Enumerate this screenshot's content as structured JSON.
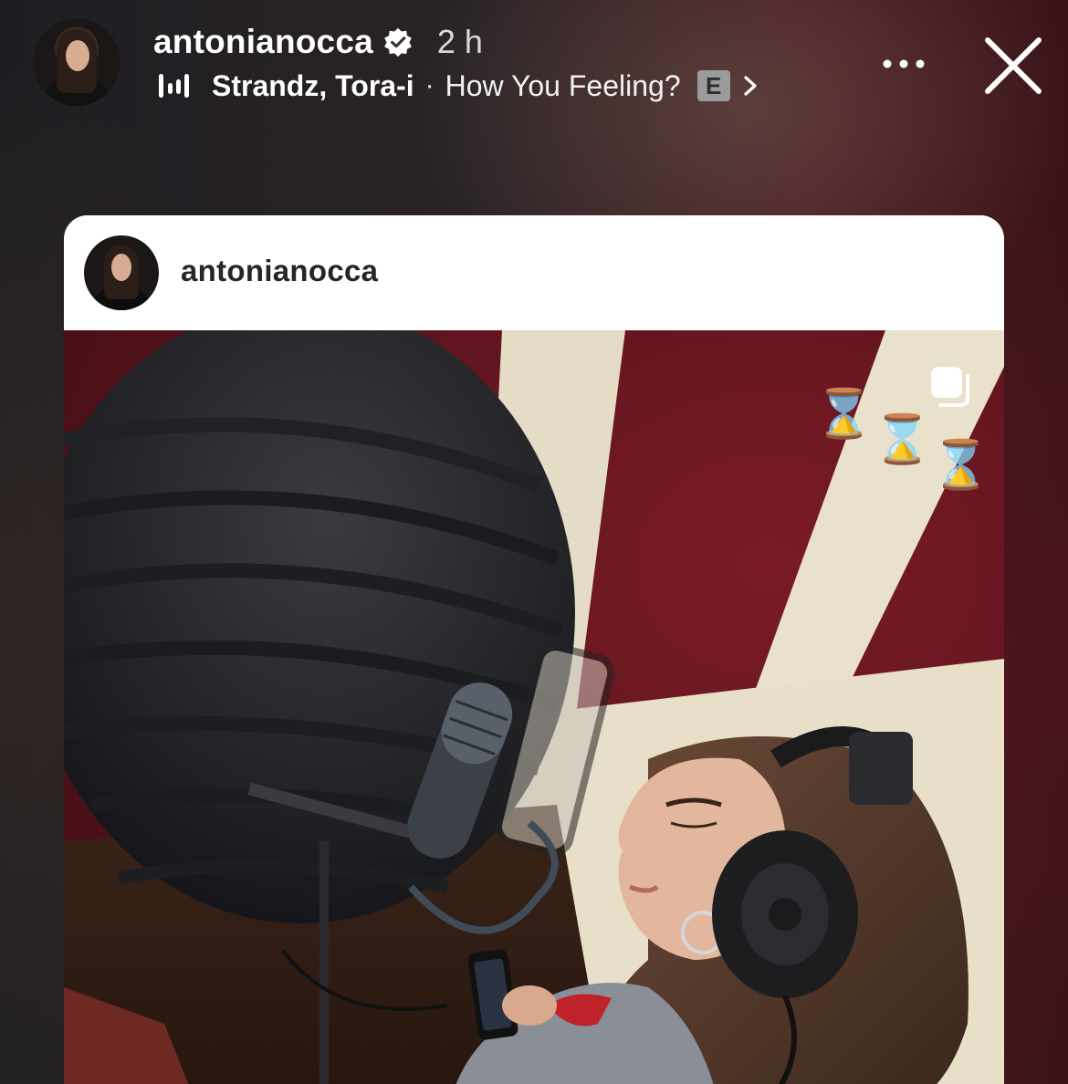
{
  "header": {
    "username": "antonianocca",
    "time": "2 h",
    "music": {
      "artist": "Strandz, Tora-i",
      "separator": "·",
      "song": "How You Feeling?",
      "explicit": "E"
    }
  },
  "post": {
    "username": "antonianocca",
    "stickers": [
      "⌛",
      "⌛",
      "⌛"
    ]
  },
  "colors": {
    "text_primary": "#ffffff",
    "post_username": "#262626",
    "verified": "#ffffff",
    "explicit_badge": "#9b9b9b",
    "studio_wall": "#6a1820"
  },
  "icons": {
    "verified": "verified-badge-icon",
    "music": "music-bars-icon",
    "chevron": "chevron-right-icon",
    "more": "more-horizontal-icon",
    "close": "close-icon",
    "carousel": "carousel-icon"
  }
}
